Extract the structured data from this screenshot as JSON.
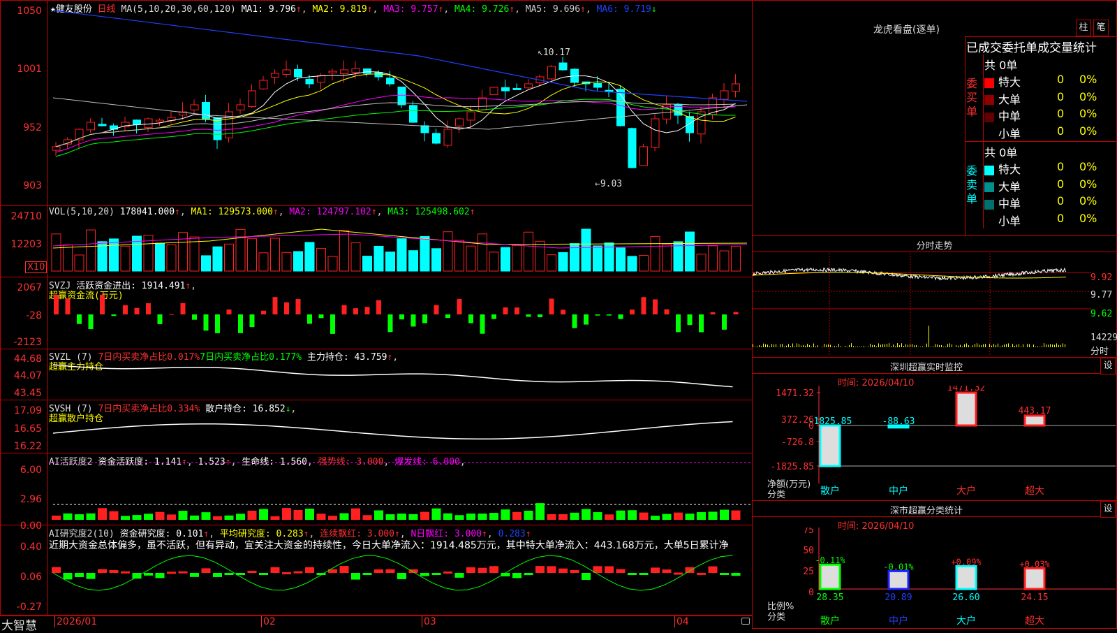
{
  "colors": {
    "up": "#ff2020",
    "down": "#00ffff",
    "grid": "#c00000",
    "ma1": "#ffffff",
    "ma2": "#ffff00",
    "ma3": "#ff00ff",
    "ma4": "#00ff00",
    "ma5": "#c0c0c0",
    "ma6": "#2040ff"
  },
  "header": {
    "star": "★",
    "stock": "健友股份",
    "period": "日线",
    "ma_label": "MA(5,10,20,30,60,120)",
    "ma1": "MA1: 9.796",
    "ma2": "MA2: 9.819",
    "ma3": "MA3: 9.757",
    "ma4": "MA4: 9.726",
    "ma5": "MA5: 9.696",
    "ma6": "MA6: 9.719"
  },
  "price_axis": [
    "1050",
    "1001",
    "952",
    "903"
  ],
  "price_annot": {
    "high": "10.17",
    "low": "9.03"
  },
  "vol": {
    "label": "VOL(5,10,20)",
    "value": "178041.000",
    "ma1": "MA1: 129573.000",
    "ma2": "MA2: 124797.102",
    "ma3": "MA3: 125498.602",
    "axis": [
      "24710",
      "12203"
    ],
    "unit": "X10"
  },
  "svzj": {
    "label": "SVZJ",
    "text": "活跃资金进出: 1914.491",
    "sub": "超赢资金流(万元)",
    "axis": [
      "2067",
      "-28",
      "-2123"
    ]
  },
  "svzl": {
    "label": "SVZL (7)",
    "a": "7日内买卖净占比0.017%",
    "b": "7日内买卖净占比0.177%",
    "c": "主力持仓: 43.759",
    "sub": "超赢主力持仓",
    "axis": [
      "44.68",
      "44.07",
      "43.45"
    ]
  },
  "svsh": {
    "label": "SVSH (7)",
    "a": "7日内买卖净占比0.334%",
    "c": "散户持仓: 16.852",
    "sub": "超赢散户持仓",
    "axis": [
      "17.09",
      "16.65",
      "16.22"
    ]
  },
  "ai1": {
    "label": "AI活跃度2",
    "a": "资金活跃度: 1.141",
    "b": "1.523",
    "c": "生命线: 1.560",
    "d": "强势线: 3.000",
    "e": "爆发线: 6.000",
    "axis": [
      "6.00",
      "2.96",
      "0.00"
    ]
  },
  "ai2": {
    "label": "AI研究度2(10)",
    "a": "资金研究度: 0.101",
    "b": "平均研究度: 0.283",
    "c": "连续飘红: 3.000",
    "d": "N日飘红: 3.000",
    "e": "0.283",
    "comment": "近期大资金总体偏多，虽不活跃，但有异动，宜关注大资金的持续性，今日大单净流入：1914.485万元，其中特大单净流入：443.168万元，大单5日累计净",
    "axis": [
      "0.40",
      "0.06",
      "-0.27"
    ]
  },
  "dates": [
    "2026/01",
    "02",
    "03",
    "04"
  ],
  "brand": "大智慧",
  "lhb": {
    "title": "龙虎看盘(逐单)",
    "btn1": "柱",
    "btn2": "笔",
    "head": "已成交委托单成交量统计",
    "buy_label": "委买单",
    "sell_label": "委卖单",
    "buy_total": "共 0单",
    "sell_total": "共 0单",
    "buy_rows": [
      {
        "name": "特大",
        "n": "0",
        "p": "0%",
        "c": "#ff0000"
      },
      {
        "name": "大单",
        "n": "0",
        "p": "0%",
        "c": "#900000"
      },
      {
        "name": "中单",
        "n": "0",
        "p": "0%",
        "c": "#600000"
      },
      {
        "name": "小单",
        "n": "0",
        "p": "0%",
        "c": "#000000"
      }
    ],
    "sell_rows": [
      {
        "name": "特大",
        "n": "0",
        "p": "0%",
        "c": "#00ffff"
      },
      {
        "name": "大单",
        "n": "0",
        "p": "0%",
        "c": "#009090"
      },
      {
        "name": "中单",
        "n": "0",
        "p": "0%",
        "c": "#007070"
      },
      {
        "name": "小单",
        "n": "0",
        "p": "0%",
        "c": "#000000"
      }
    ]
  },
  "intraday": {
    "title": "分时走势",
    "axis": [
      "9.92",
      "9.77",
      "9.62",
      "14229"
    ],
    "unit": "分时"
  },
  "monitor": {
    "title": "深圳超赢实时监控",
    "btn": "设",
    "time": "时间: 2026/04/10",
    "axis": [
      "1471.32",
      "372.26",
      "0",
      "-726.8",
      "-1825.85"
    ],
    "ylabel": "净额(万元)",
    "xlabel": "分类",
    "cats": [
      "散户",
      "中户",
      "大户",
      "超大"
    ],
    "values": [
      -1825.85,
      -88.63,
      1471.32,
      443.17
    ],
    "value_labels": [
      "-1825.85",
      "-88.63",
      "1471.32",
      "443.17"
    ]
  },
  "classify": {
    "title": "深市超赢分类统计",
    "btn": "设",
    "time": "时间: 2026/04/10",
    "axis": [
      "75",
      "50",
      "25",
      "0"
    ],
    "ylabel": "比例%",
    "xlabel": "分类",
    "cats": [
      "散户",
      "中户",
      "大户",
      "超大"
    ],
    "values": [
      28.35,
      20.89,
      26.6,
      24.15
    ],
    "value_labels": [
      "28.35",
      "20.89",
      "26.60",
      "24.15"
    ],
    "changes": [
      "-0.11%",
      "-0.01%",
      "+0.09%",
      "+0.03%"
    ]
  }
}
